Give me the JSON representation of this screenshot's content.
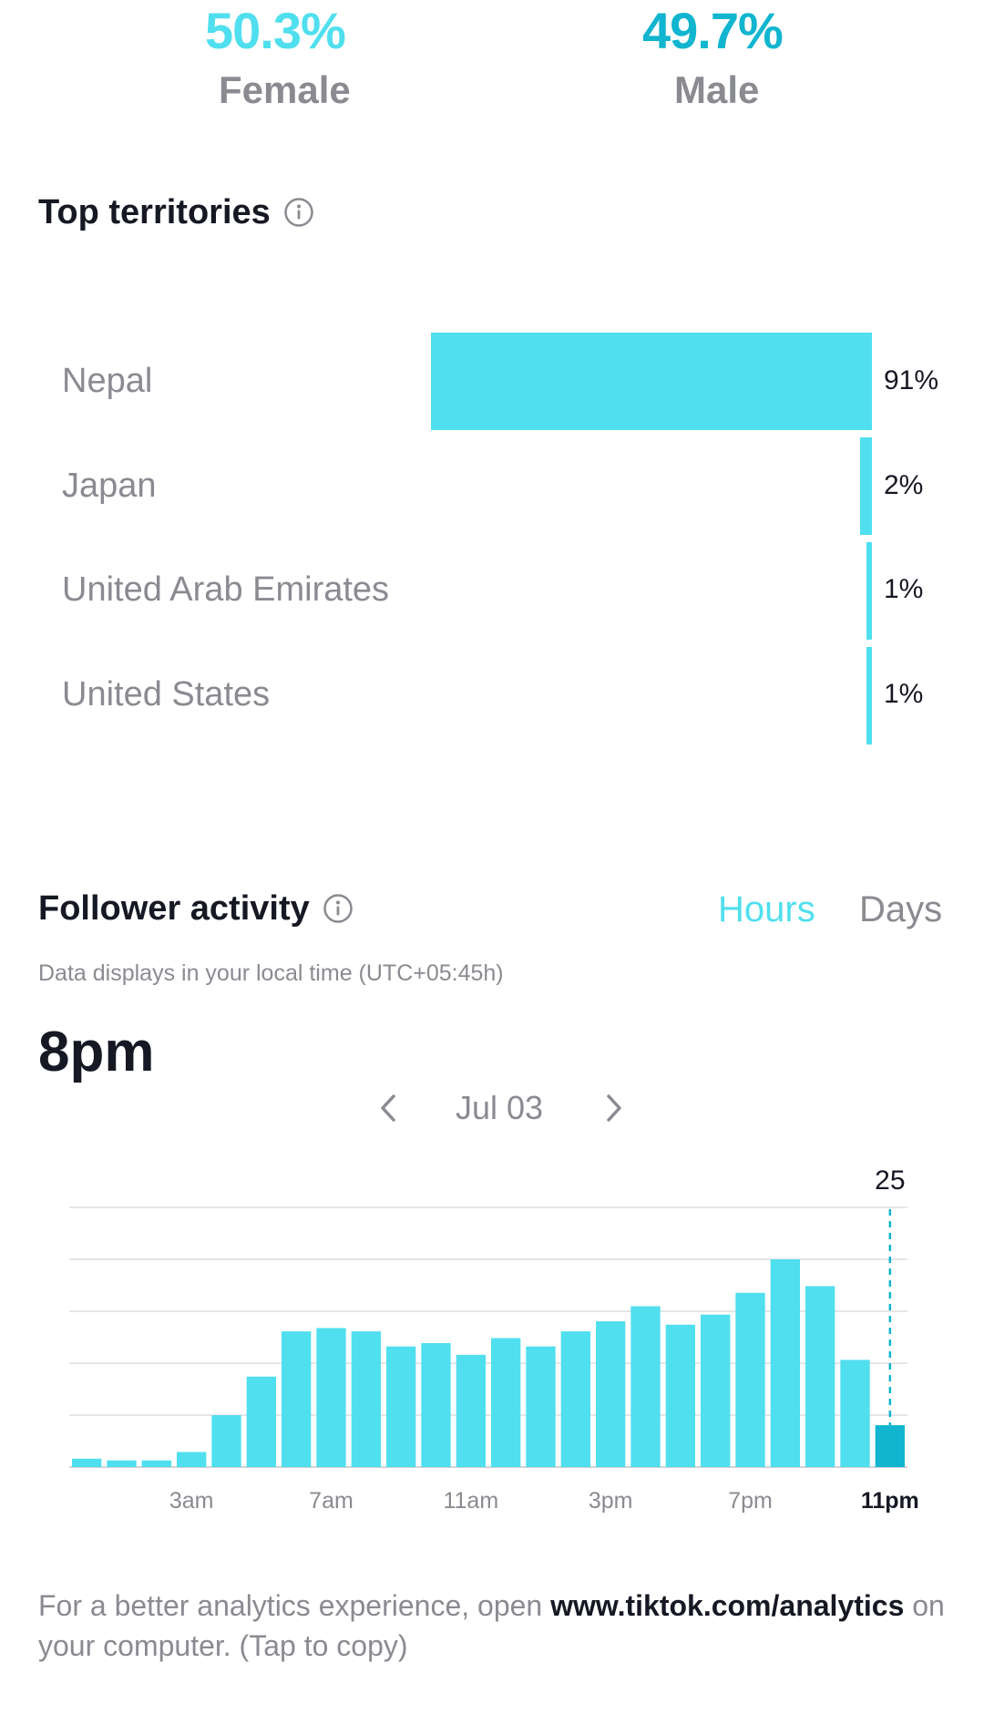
{
  "gender": {
    "female": {
      "pct": "50.3%",
      "label": "Female",
      "color": "#50dfee"
    },
    "male": {
      "pct": "49.7%",
      "label": "Male",
      "color": "#11b5cf"
    }
  },
  "territories": {
    "title": "Top territories",
    "info_icon": "info-icon",
    "items": [
      {
        "name": "Nepal",
        "pct": "91%",
        "value": 91
      },
      {
        "name": "Japan",
        "pct": "2%",
        "value": 2
      },
      {
        "name": "United Arab Emirates",
        "pct": "1%",
        "value": 1
      },
      {
        "name": "United States",
        "pct": "1%",
        "value": 1
      }
    ]
  },
  "activity": {
    "title": "Follower activity",
    "info_icon": "info-icon",
    "toggle": {
      "hours": "Hours",
      "days": "Days",
      "selected": "hours"
    },
    "subtitle": "Data displays in your local time (UTC+05:45h)",
    "peak": "8pm",
    "date": "Jul 03",
    "prev_icon": "chevron-left-icon",
    "next_icon": "chevron-right-icon",
    "selected_value_label": "25",
    "accent": "#50dfee",
    "selected_color": "#11b5cf"
  },
  "chart_data": {
    "type": "bar",
    "categories": [
      "12am",
      "1am",
      "2am",
      "3am",
      "4am",
      "5am",
      "6am",
      "7am",
      "8am",
      "9am",
      "10am",
      "11am",
      "12pm",
      "1pm",
      "2pm",
      "3pm",
      "4pm",
      "5pm",
      "6pm",
      "7pm",
      "8pm",
      "9pm",
      "10pm",
      "11pm"
    ],
    "values": [
      5,
      4,
      4,
      9,
      31,
      54,
      81,
      83,
      81,
      72,
      74,
      67,
      77,
      72,
      81,
      87,
      96,
      85,
      91,
      104,
      124,
      108,
      64,
      25
    ],
    "tick_labels": [
      "3am",
      "7am",
      "11am",
      "3pm",
      "7pm",
      "11pm"
    ],
    "selected_index": 23,
    "selected_label": "25",
    "ylim": [
      0,
      155
    ],
    "grid": true
  },
  "footer": {
    "text_before": "For a better analytics experience, open ",
    "link": "www.tiktok.com/analytics",
    "text_after": " on your computer. (Tap to copy)"
  }
}
